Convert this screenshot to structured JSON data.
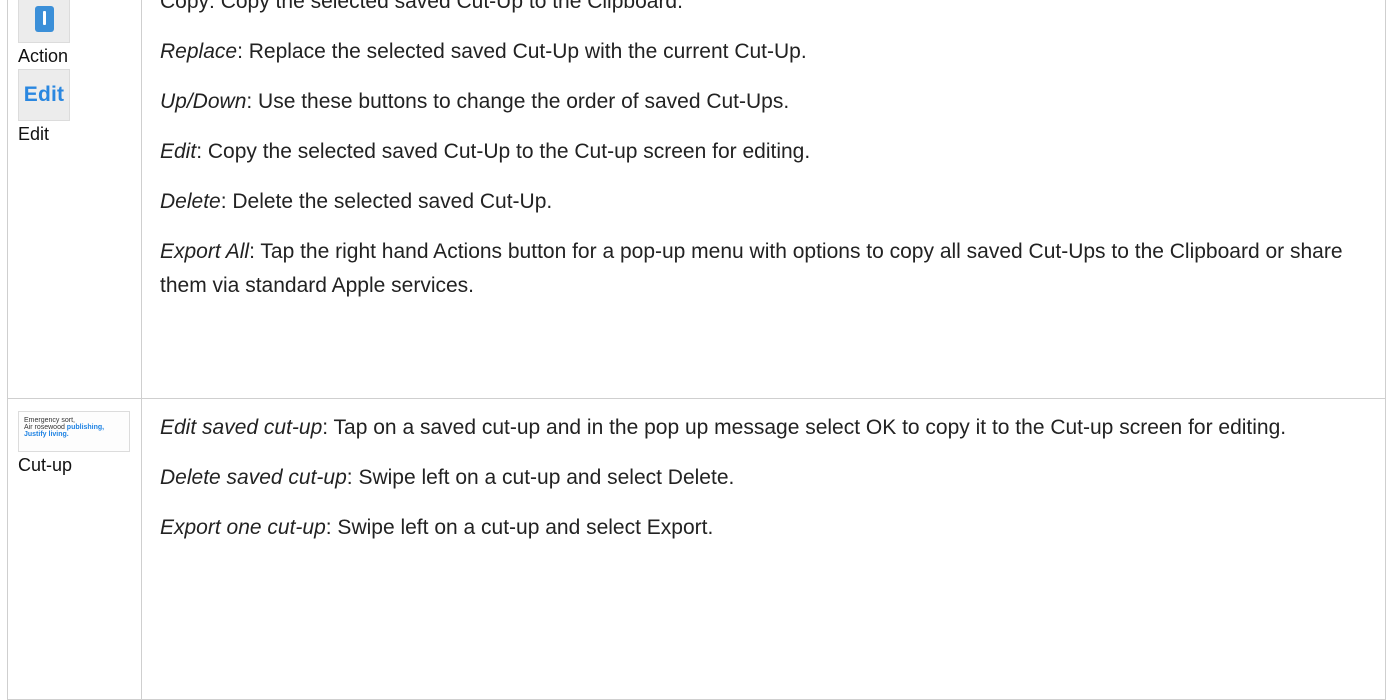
{
  "row1": {
    "icons": {
      "action_caption": "Action",
      "edit_thumb_label": "Edit",
      "edit_caption": "Edit"
    },
    "clipped_line": "Copy: Copy the selected saved Cut-Up to the Clipboard.",
    "items": [
      {
        "term": "Replace",
        "text": ": Replace the selected saved Cut-Up with the current Cut-Up."
      },
      {
        "term": "Up/Down",
        "text": ": Use these buttons to change the order of saved Cut-Ups."
      },
      {
        "term": "Edit",
        "text": ": Copy the selected saved Cut-Up to the Cut-up screen for editing."
      },
      {
        "term": "Delete",
        "text": ": Delete the selected saved Cut-Up."
      },
      {
        "term": "Export All",
        "text": ": Tap the right hand Actions button for a pop-up menu with options to copy all saved Cut-Ups to the Clipboard or share them via standard Apple services."
      }
    ]
  },
  "row2": {
    "thumbnail": {
      "line1": "Emergency sort,",
      "line2_dark": "Air rosewood ",
      "line2_blue": "publishing,",
      "line3_blue": "Justify living."
    },
    "caption": "Cut-up",
    "items": [
      {
        "term": "Edit saved cut-up",
        "text": ": Tap on a saved cut-up and in the pop up message select OK to copy it to the Cut-up screen for editing."
      },
      {
        "term": "Delete saved cut-up",
        "text": ": Swipe left on a cut-up and select Delete."
      },
      {
        "term": "Export one cut-up",
        "text": ": Swipe left on a cut-up and select Export."
      }
    ]
  },
  "colors": {
    "accent_blue": "#2a87e0",
    "border": "#cfcfcf",
    "text": "#222222"
  }
}
